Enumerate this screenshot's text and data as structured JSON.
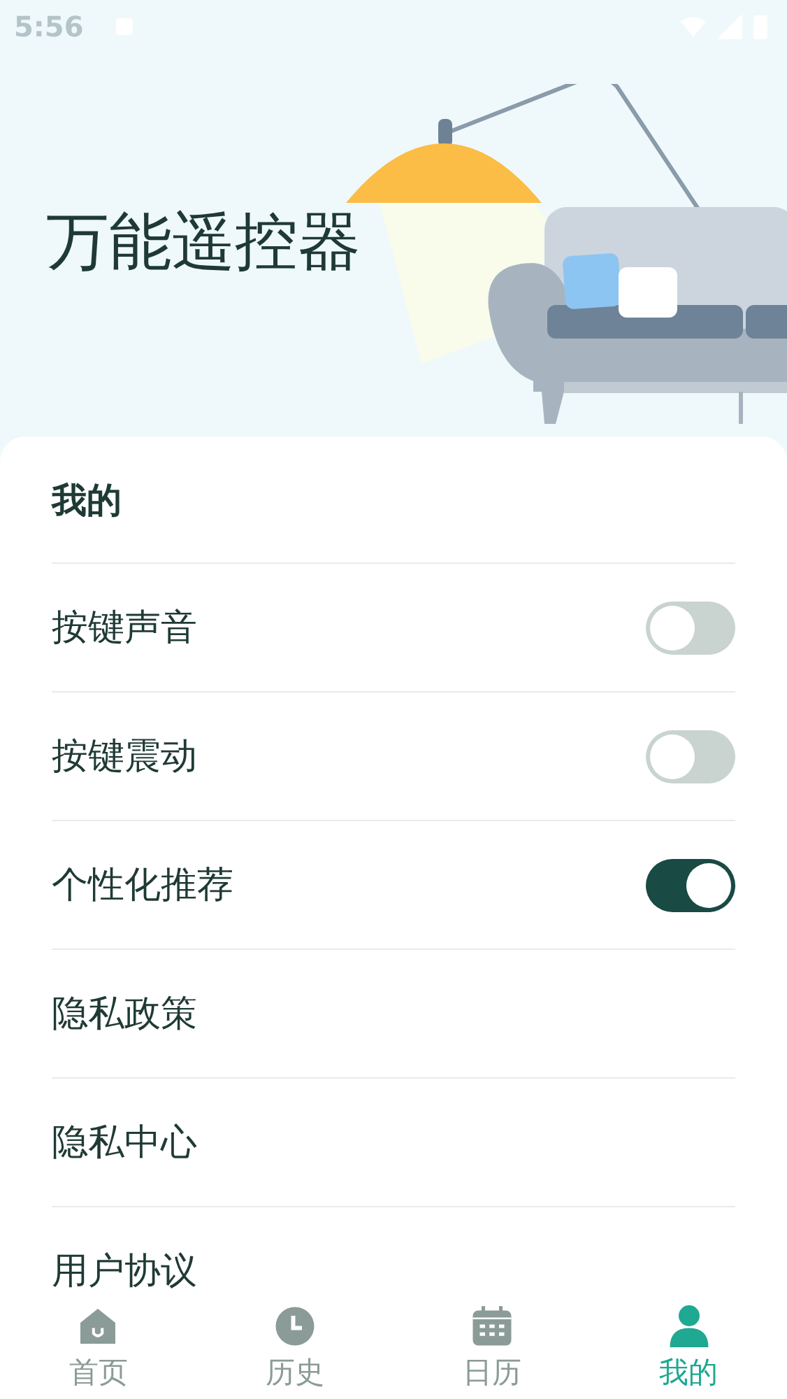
{
  "status_bar": {
    "time": "5:56"
  },
  "header": {
    "title": "万能遥控器"
  },
  "section": {
    "title": "我的"
  },
  "settings": [
    {
      "kind": "toggle",
      "label": "按键声音",
      "on": false
    },
    {
      "kind": "toggle",
      "label": "按键震动",
      "on": false
    },
    {
      "kind": "toggle",
      "label": "个性化推荐",
      "on": true
    },
    {
      "kind": "link",
      "label": "隐私政策"
    },
    {
      "kind": "link",
      "label": "隐私中心"
    },
    {
      "kind": "link",
      "label": "用户协议"
    }
  ],
  "tabs": [
    {
      "kind": "home",
      "label": "首页",
      "selected": false
    },
    {
      "kind": "history",
      "label": "历史",
      "selected": false
    },
    {
      "kind": "calendar",
      "label": "日历",
      "selected": false
    },
    {
      "kind": "profile",
      "label": "我的",
      "selected": true
    }
  ]
}
